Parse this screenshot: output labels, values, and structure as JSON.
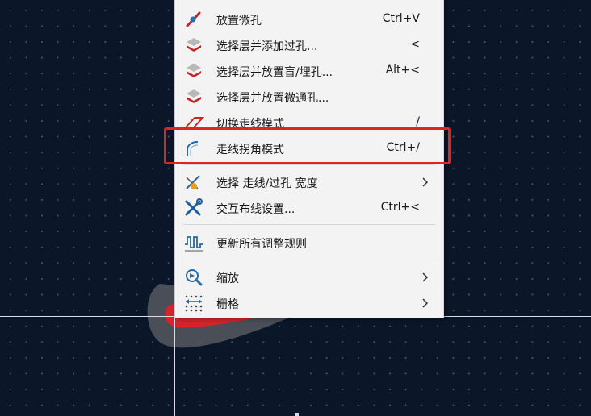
{
  "colors": {
    "canvas_bg": "#0b1628",
    "grid_dot": "#788caa",
    "menu_bg": "#f3f3f3",
    "highlight_box": "#e0251f",
    "track_red": "#d9232a",
    "track_clearance": "#4a4f57"
  },
  "menu": {
    "items": [
      {
        "label": "放置微孔",
        "shortcut": "Ctrl+V",
        "icon": "micro-via-icon"
      },
      {
        "label": "选择层并添加过孔...",
        "shortcut": "<",
        "icon": "layer-stack-icon"
      },
      {
        "label": "选择层并放置盲/埋孔...",
        "shortcut": "Alt+<",
        "icon": "layer-stack-icon"
      },
      {
        "label": "选择层并放置微通孔...",
        "shortcut": "",
        "icon": "layer-stack-icon"
      },
      {
        "label": "切换走线模式",
        "shortcut": "/",
        "icon": "track-mode-icon"
      },
      {
        "label": "走线拐角模式",
        "shortcut": "Ctrl+/",
        "icon": "corner-mode-icon"
      },
      {
        "label": "选择 走线/过孔 宽度",
        "shortcut": "",
        "icon": "track-width-icon",
        "submenu": true
      },
      {
        "label": "交互布线设置...",
        "shortcut": "Ctrl+<",
        "icon": "tools-icon"
      },
      {
        "label": "更新所有调整规则",
        "shortcut": "",
        "icon": "meander-icon"
      },
      {
        "label": "缩放",
        "shortcut": "",
        "icon": "zoom-icon",
        "submenu": true
      },
      {
        "label": "栅格",
        "shortcut": "",
        "icon": "grid-icon",
        "submenu": true
      }
    ]
  }
}
